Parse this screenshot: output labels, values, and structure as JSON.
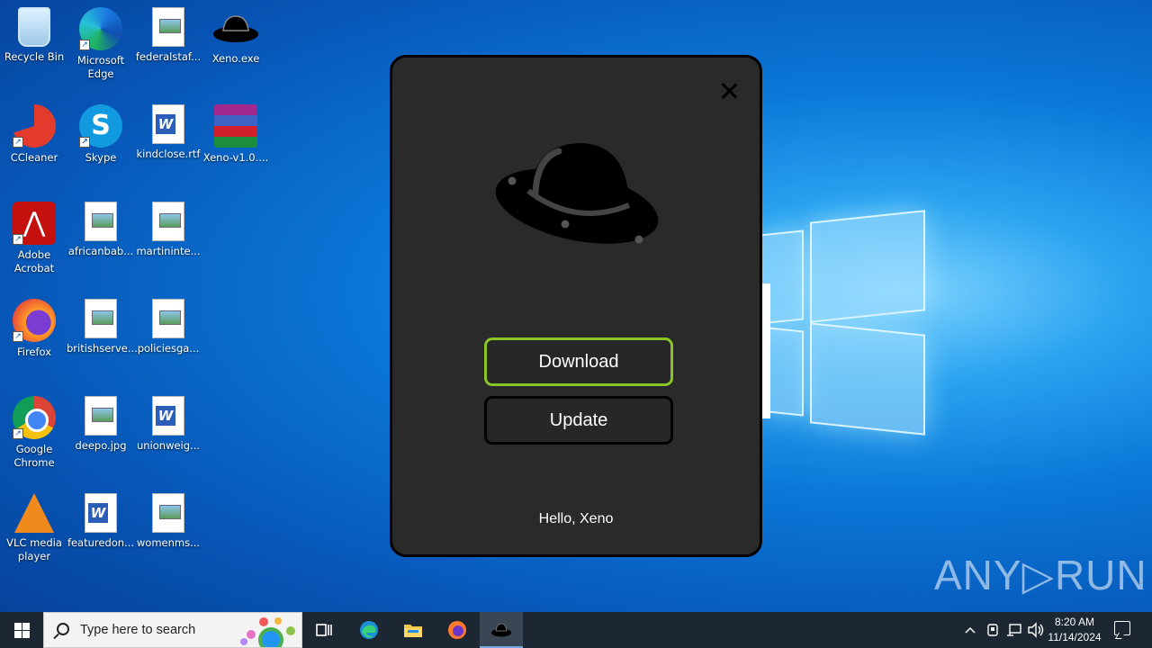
{
  "desktop": {
    "icons": [
      {
        "label": "Recycle Bin"
      },
      {
        "label": "Microsoft Edge"
      },
      {
        "label": "federalstaf..."
      },
      {
        "label": "Xeno.exe"
      },
      {
        "label": "CCleaner"
      },
      {
        "label": "Skype"
      },
      {
        "label": "kindclose.rtf"
      },
      {
        "label": "Xeno-v1.0...."
      },
      {
        "label": "Adobe Acrobat"
      },
      {
        "label": "africanbab..."
      },
      {
        "label": "martininte..."
      },
      {
        "label": "Firefox"
      },
      {
        "label": "britishserve..."
      },
      {
        "label": "policiesga..."
      },
      {
        "label": "Google Chrome"
      },
      {
        "label": "deepo.jpg"
      },
      {
        "label": "unionweig..."
      },
      {
        "label": "VLC media player"
      },
      {
        "label": "featuredon..."
      },
      {
        "label": "womenms..."
      }
    ]
  },
  "app_window": {
    "download_label": "Download",
    "update_label": "Update",
    "greeting": "Hello, Xeno",
    "accent_color": "#8bc425"
  },
  "watermark": {
    "text": "ANY▷RUN"
  },
  "taskbar": {
    "search_placeholder": "Type here to search",
    "time": "8:20 AM",
    "date": "11/14/2024"
  }
}
